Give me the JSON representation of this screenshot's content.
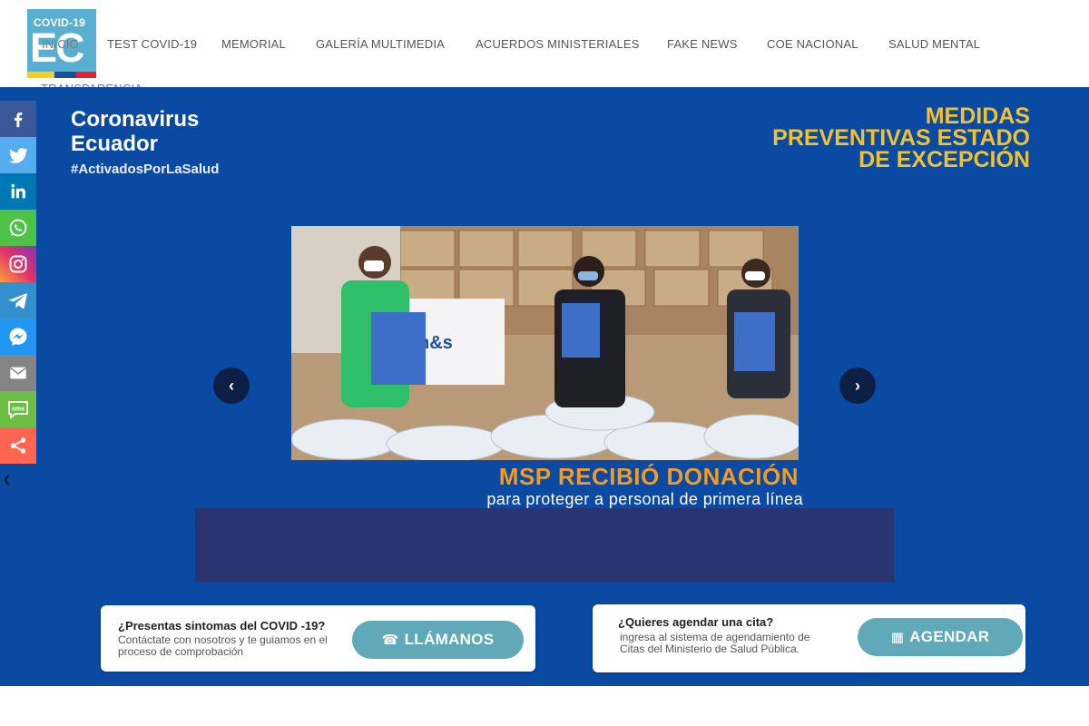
{
  "logo": {
    "top_text": "COVID-19",
    "main_text": "EC",
    "flag_colors": [
      "#f7d117",
      "#1a4fa0",
      "#e0262d"
    ]
  },
  "nav": {
    "items": [
      {
        "label": "Inicio"
      },
      {
        "label": "Test COVID-19"
      },
      {
        "label": "Memorial"
      },
      {
        "label": "Galería Multimedia"
      },
      {
        "label": "Acuerdos Ministeriales"
      },
      {
        "label": "Fake News"
      },
      {
        "label": "COE Nacional"
      },
      {
        "label": "Salud Mental"
      },
      {
        "label": "Transparencia"
      }
    ]
  },
  "hero": {
    "brand_line1": "Coronavirus",
    "brand_line2": "Ecuador",
    "brand_tag": "#ActivadosPorLaSalud",
    "measures_line1": "MEDIDAS",
    "measures_line2": "PREVENTIVAS ESTADO",
    "measures_line3": "DE EXCEPCIÓN",
    "slide_caption_title": "MSP RECIBIÓ DONACIÓN",
    "slide_caption_sub": "para proteger a personal de primera línea",
    "arrow_prev": "‹",
    "arrow_next": "›"
  },
  "cta_symptoms": {
    "title": "¿Presentas sintomas del COVID -19?",
    "text": "Contáctate con nosotros y te guiamos en el proceso de comprobación",
    "button": "LLÁMANOS",
    "button_icon": "phone-icon"
  },
  "cta_appointment": {
    "title": "¿Quieres agendar una cita?",
    "text": "ingresa al sistema de agendamiento de Citas del Ministerio de Salud Pública.",
    "button": "AGENDAR",
    "button_icon": "calendar-icon"
  },
  "share": {
    "buttons": [
      {
        "name": "facebook",
        "color": "#3b5998"
      },
      {
        "name": "twitter",
        "color": "#55acee"
      },
      {
        "name": "linkedin",
        "color": "#0077b5"
      },
      {
        "name": "whatsapp",
        "color": "#4dc247"
      },
      {
        "name": "instagram",
        "color": "#c13584"
      },
      {
        "name": "telegram",
        "color": "#3390cc"
      },
      {
        "name": "messenger",
        "color": "#2196f3"
      },
      {
        "name": "email",
        "color": "#848484"
      },
      {
        "name": "sms",
        "color": "#6cbe45"
      },
      {
        "name": "more",
        "color": "#ff6550"
      }
    ],
    "hide_label": "❮"
  },
  "colors": {
    "hero_blue": "#0a4aa3",
    "accent_yellow": "#f2c12e",
    "accent_orange": "#f39a1f",
    "button_teal": "#5fa9b8"
  }
}
